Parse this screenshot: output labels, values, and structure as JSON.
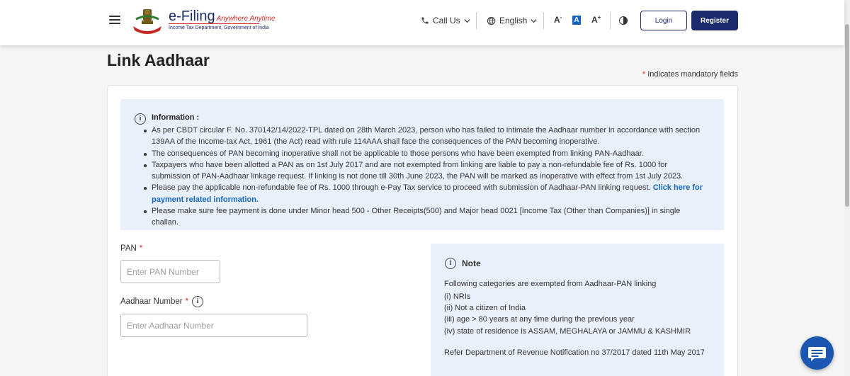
{
  "header": {
    "logo_title": "e-Filing",
    "logo_tagline": "Anywhere Anytime",
    "logo_subtitle": "Income Tax Department, Government of India",
    "call_us": "Call Us",
    "language": "English",
    "font_decrease": "A",
    "font_normal": "A",
    "font_increase": "A",
    "login": "Login",
    "register": "Register"
  },
  "page": {
    "title": "Link Aadhaar",
    "mandatory_star": "*",
    "mandatory_text": "Indicates mandatory fields"
  },
  "info": {
    "title": "Information :",
    "items": [
      "As per CBDT circular F. No. 370142/14/2022-TPL dated on 28th March 2023, person who has failed to intimate the Aadhaar number in accordance with section 139AA of the Income-tax Act, 1961 (the Act) read with rule 114AAA shall face the consequences of the PAN becoming inoperative.",
      "The consequences of PAN becoming inoperative shall not be applicable to those persons who have been exempted from linking PAN-Aadhaar.",
      "Taxpayers who have been allotted a PAN as on 1st July 2017 and are not exempted from linking are liable to pay a non-refundable fee of Rs. 1000 for submission of PAN-Aadhaar linkage request. If linking is not done till 30th June 2023, the PAN will be marked as inoperative with effect from 1st July 2023.",
      "Please pay the applicable non-refundable fee of Rs. 1000 through e-Pay Tax service to proceed with submission of Aadhaar-PAN linking request.",
      "Please make sure fee payment is done under Minor head 500 - Other Receipts(500) and Major head 0021 [Income Tax (Other than Companies)] in single challan."
    ],
    "payment_link": "Click here for payment related information."
  },
  "form": {
    "pan_label": "PAN",
    "pan_placeholder": "Enter PAN Number",
    "pan_value": "",
    "aadhaar_label": "Aadhaar Number",
    "aadhaar_placeholder": "Enter Aadhaar Number",
    "aadhaar_value": "",
    "required_star": "*"
  },
  "note": {
    "title": "Note",
    "intro": "Following categories are exempted from Aadhaar-PAN linking",
    "items": [
      "(i) NRIs",
      "(ii) Not a citizen of India",
      "(iii) age > 80 years at any time during the previous year",
      "(iv) state of residence is ASSAM, MEGHALAYA or JAMMU & KASHMIR"
    ],
    "reference": "Refer Department of Revenue Notification no 37/2017 dated 11th May 2017"
  },
  "colors": {
    "brand_navy": "#1c2b6b",
    "link_blue": "#1565c0",
    "required_red": "#d12a2a",
    "info_bg": "#e8f0fb"
  },
  "icons": [
    "menu-icon",
    "emblem-logo",
    "phone-icon",
    "chevron-down-icon",
    "globe-icon",
    "contrast-icon",
    "info-icon",
    "chat-icon"
  ]
}
